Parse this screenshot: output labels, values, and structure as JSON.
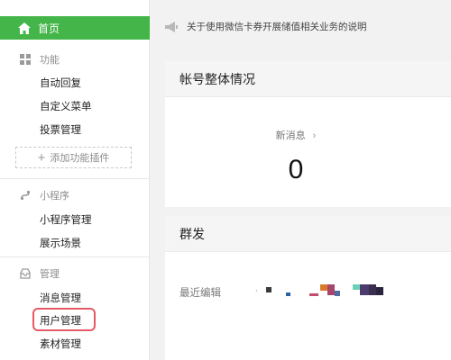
{
  "sidebar": {
    "home_label": "首页",
    "sections": [
      {
        "icon": "grid-icon",
        "title": "功能",
        "items": [
          "自动回复",
          "自定义菜单",
          "投票管理"
        ]
      },
      {
        "icon": "miniprogram-icon",
        "title": "小程序",
        "items": [
          "小程序管理",
          "展示场景"
        ]
      },
      {
        "icon": "inbox-icon",
        "title": "管理",
        "items": [
          "消息管理",
          "用户管理",
          "素材管理"
        ]
      }
    ],
    "add_plugin_label": "添加功能插件"
  },
  "notice": {
    "text": "关于使用微信卡券开展储值相关业务的说明"
  },
  "account_overview": {
    "title": "帐号整体情况",
    "new_messages_label": "新消息",
    "new_messages_count": "0"
  },
  "mass_send": {
    "title": "群发",
    "recent_edit_label": "最近编辑"
  },
  "colors": {
    "accent": "#44b549",
    "highlight": "#e65a67"
  }
}
